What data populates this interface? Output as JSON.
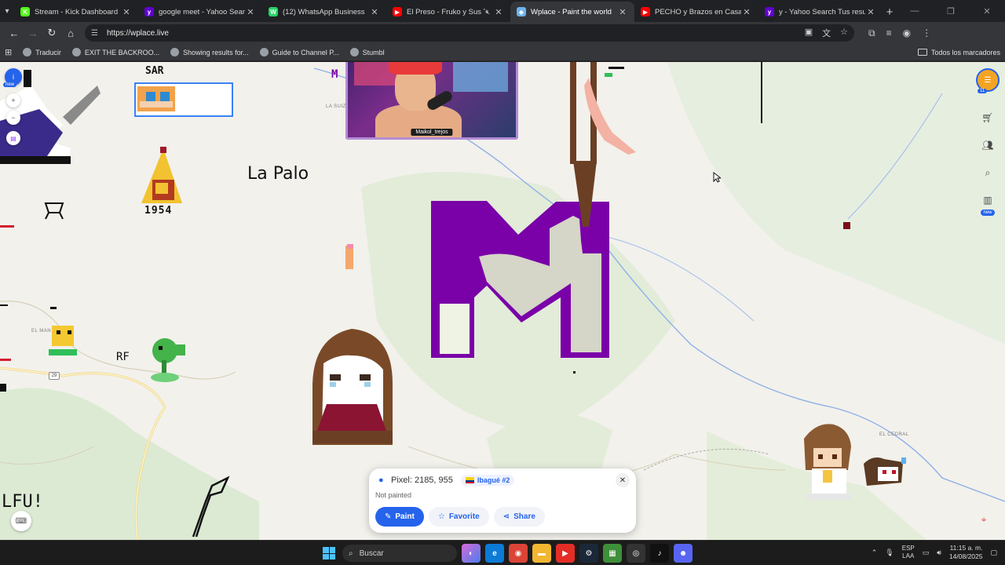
{
  "browser": {
    "tabs": [
      {
        "label": "Stream - Kick Dashboard",
        "fav_color": "#53fc18",
        "fav_glyph": "K"
      },
      {
        "label": "google meet - Yahoo Search Tu",
        "fav_color": "#6001d2",
        "fav_glyph": "y"
      },
      {
        "label": "(12) WhatsApp Business",
        "fav_color": "#25d366",
        "fav_glyph": "W"
      },
      {
        "label": "El Preso - Fruko y Sus Teso",
        "fav_color": "#ff0000",
        "fav_glyph": "▶"
      },
      {
        "label": "Wplace - Paint the world",
        "fav_color": "#6cb4ee",
        "fav_glyph": "◆",
        "active": true
      },
      {
        "label": "PECHO y Brazos en Casa - Haz",
        "fav_color": "#ff0000",
        "fav_glyph": "▶"
      },
      {
        "label": "y - Yahoo Search Tus resultado",
        "fav_color": "#6001d2",
        "fav_glyph": "y"
      }
    ],
    "url": "https://wplace.live",
    "bookmarks": [
      "Traducir",
      "EXIT THE BACKROO...",
      "Showing results for...",
      "Guide to Channel P...",
      "Stumbl"
    ],
    "all_bookmarks": "Todos los marcadores"
  },
  "map": {
    "place_labels": [
      {
        "text": "LA SUIZ",
        "id": "la-suiza"
      },
      {
        "text": "EL MAN",
        "id": "el-man"
      },
      {
        "text": "EL CEDRAL",
        "id": "el-cedral"
      }
    ],
    "highway_shield": "29",
    "pixel_texts": {
      "sar": "SAR",
      "la_palo": "La Palo",
      "year": "1954",
      "rf": "RF",
      "m_small": "M",
      "bottom_left": "LFU!"
    },
    "left_badge_new": "new"
  },
  "webcam": {
    "channel_name": "Maikol_trejos"
  },
  "right_toolbar": {
    "avatar_count": "11",
    "new_badge": "new"
  },
  "popup": {
    "pixel_label": "Pixel: 2185, 955",
    "region": "Ibagué #2",
    "status": "Not painted",
    "paint": "Paint",
    "favorite": "Favorite",
    "share": "Share"
  },
  "taskbar": {
    "search": "Buscar",
    "lang_top": "ESP",
    "lang_bottom": "LAA",
    "time": "11:15 a. m.",
    "date": "14/08/2025"
  },
  "colors": {
    "accent": "#2563eb",
    "purple_art": "#7a00a8",
    "brown_art": "#6b3f24"
  }
}
